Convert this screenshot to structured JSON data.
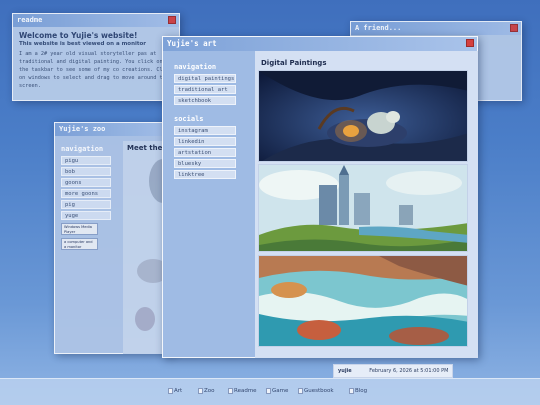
{
  "readme": {
    "title": "readme",
    "heading": "Welcome to Yujie's website!",
    "subheading": "This website is best viewed on a monitor",
    "body": "I am a 2# year old visual storyteller pas at traditional and digital painting. You click on the taskbar to see some of my co creations. Click on windows to select and drag to move around the screen."
  },
  "friend": {
    "title": "A friend..."
  },
  "zoo": {
    "title": "Yujie's zoo",
    "nav_heading": "navigation",
    "items": [
      "pigu",
      "bob",
      "goons",
      "more goons",
      "pig",
      "yuge"
    ],
    "meet": "Meet the",
    "badge1": "Windows Media Player",
    "badge2": "a computer and a monitor"
  },
  "art": {
    "title": "Yujie's art",
    "nav_heading": "navigation",
    "nav": [
      "digital paintings",
      "traditional art",
      "sketchbook"
    ],
    "socials_heading": "socials",
    "socials": [
      "instagram",
      "linkedin",
      "artstation",
      "bluesky",
      "linktree"
    ],
    "section_title": "Digital Paintings"
  },
  "comment": {
    "author": "yujie",
    "date": "February 6, 2026 at 5:01:00 PM"
  },
  "taskbar": [
    "Art",
    "Zoo",
    "Readme",
    "Game",
    "Guestbook",
    "Blog"
  ],
  "colors": {
    "close": "#d5403f",
    "titlebar": "#8fb0e0",
    "desktop": "#4b7ec8"
  }
}
